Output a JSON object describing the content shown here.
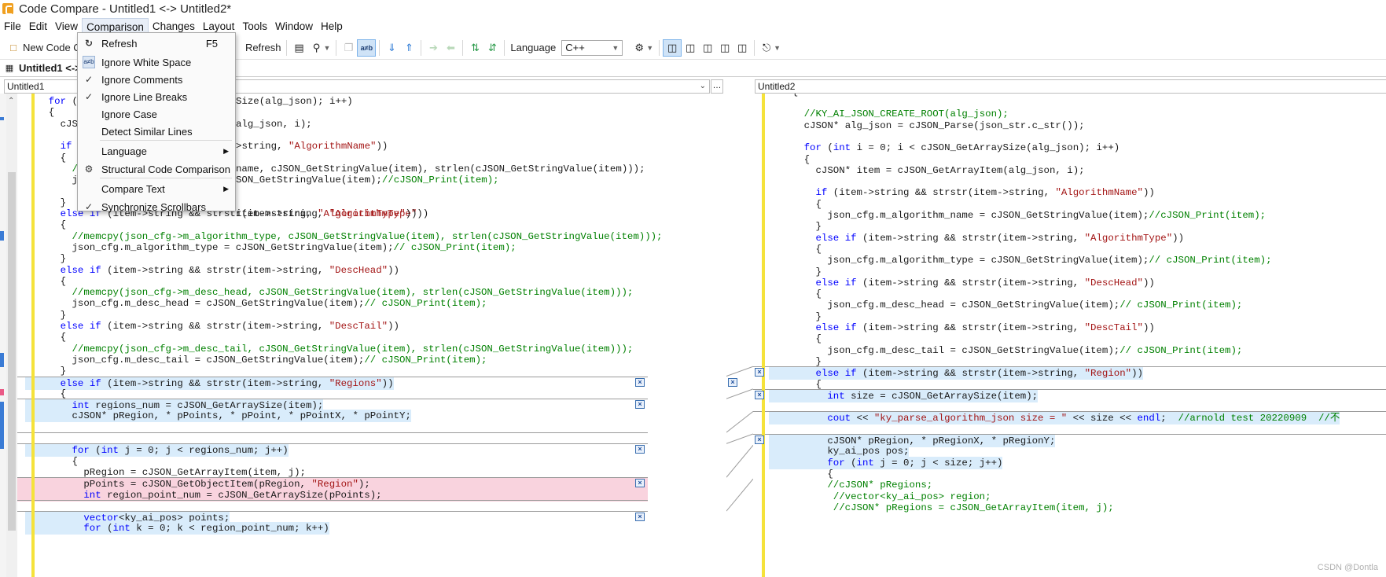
{
  "window": {
    "title": "Code Compare - Untitled1 <-> Untitled2*"
  },
  "menubar": [
    "File",
    "Edit",
    "View",
    "Comparison",
    "Changes",
    "Layout",
    "Tools",
    "Window",
    "Help"
  ],
  "toolbar": {
    "new_code": "New Code Co",
    "refresh": "Refresh",
    "language_label": "Language",
    "language_value": "C++"
  },
  "doc_tab": {
    "label": "Untitled1 <-> U"
  },
  "left_header": "Untitled1",
  "right_header": "Untitled2",
  "comparison_menu": {
    "items": [
      {
        "label": "Refresh",
        "shortcut": "F5",
        "icon": "refresh-icon"
      },
      {
        "label": "Ignore White Space",
        "icon": "axb-icon"
      },
      {
        "label": "Ignore Comments",
        "icon": "check-icon",
        "checked": true
      },
      {
        "label": "Ignore Line Breaks",
        "icon": "check-icon",
        "checked": true
      },
      {
        "label": "Ignore Case"
      },
      {
        "label": "Detect Similar Lines"
      },
      {
        "label": "Language",
        "submenu": true
      },
      {
        "label": "Structural Code Comparison",
        "icon": "structure-icon"
      },
      {
        "label": "Compare Text",
        "submenu": true
      },
      {
        "label": "Synchronize Scrollbars",
        "icon": "check-icon",
        "checked": true
      }
    ]
  },
  "left_lines": [
    "    for (i",
    "    {",
    "      cJSON",
    "",
    "      if (",
    "      {",
    "        //",
    "        js",
    "",
    "      }",
    "      else if (item->string && strstr(item->string, \"AlgorithmType\"))",
    "      {",
    "        //memcpy(json_cfg->m_algorithm_type, cJSON_GetStringValue(item), strlen(cJSON_GetStringValue(item)));",
    "        json_cfg.m_algorithm_type = cJSON_GetStringValue(item);// cJSON_Print(item);",
    "      }",
    "      else if (item->string && strstr(item->string, \"DescHead\"))",
    "      {",
    "        //memcpy(json_cfg->m_desc_head, cJSON_GetStringValue(item), strlen(cJSON_GetStringValue(item)));",
    "        json_cfg.m_desc_head = cJSON_GetStringValue(item);// cJSON_Print(item);",
    "      }",
    "      else if (item->string && strstr(item->string, \"DescTail\"))",
    "      {",
    "        //memcpy(json_cfg->m_desc_tail, cJSON_GetStringValue(item), strlen(cJSON_GetStringValue(item)));",
    "        json_cfg.m_desc_tail = cJSON_GetStringValue(item);// cJSON_Print(item);",
    "      }",
    "      else if (item->string && strstr(item->string, \"Regions\"))",
    "      {",
    "        int regions_num = cJSON_GetArraySize(item);",
    "        cJSON* pRegion, * pPoints, * pPoint, * pPointX, * pPointY;",
    "",
    "",
    "        for (int j = 0; j < regions_num; j++)",
    "        {",
    "          pRegion = cJSON_GetArrayItem(item, j);",
    "          pPoints = cJSON_GetObjectItem(pRegion, \"Region\");",
    "          int region_point_num = cJSON_GetArraySize(pPoints);",
    "",
    "          vector<ky_ai_pos> points;",
    "          for (int k = 0; k < region_point_num; k++)"
  ],
  "left_fragments": {
    "l0": "Size(alg_json); i++)",
    "l2": "alg_json, i);",
    "l4": ">string, \"AlgorithmName\"))",
    "l6": "name, cJSON_GetStringValue(item), strlen(cJSON_GetStringValue(item)));",
    "l7": "SON_GetStringValue(item);//cJSON_Print(item);",
    "l10": "item->string, \"AlgorithmType\"))"
  },
  "right_lines": [
    "    {",
    "",
    "      //KY_AI_JSON_CREATE_ROOT(alg_json);",
    "      cJSON* alg_json = cJSON_Parse(json_str.c_str());",
    "",
    "      for (int i = 0; i < cJSON_GetArraySize(alg_json); i++)",
    "      {",
    "        cJSON* item = cJSON_GetArrayItem(alg_json, i);",
    "",
    "        if (item->string && strstr(item->string, \"AlgorithmName\"))",
    "        {",
    "          json_cfg.m_algorithm_name = cJSON_GetStringValue(item);//cJSON_Print(item);",
    "        }",
    "        else if (item->string && strstr(item->string, \"AlgorithmType\"))",
    "        {",
    "          json_cfg.m_algorithm_type = cJSON_GetStringValue(item);// cJSON_Print(item);",
    "        }",
    "        else if (item->string && strstr(item->string, \"DescHead\"))",
    "        {",
    "          json_cfg.m_desc_head = cJSON_GetStringValue(item);// cJSON_Print(item);",
    "        }",
    "        else if (item->string && strstr(item->string, \"DescTail\"))",
    "        {",
    "          json_cfg.m_desc_tail = cJSON_GetStringValue(item);// cJSON_Print(item);",
    "        }",
    "        else if (item->string && strstr(item->string, \"Region\"))",
    "        {",
    "          int size = cJSON_GetArraySize(item);",
    "",
    "          cout << \"ky_parse_algorithm_json size = \" << size << endl;  //arnold test 20220909  //不",
    "",
    "          cJSON* pRegion, * pRegionX, * pRegionY;",
    "          ky_ai_pos pos;",
    "          for (int j = 0; j < size; j++)",
    "          {",
    "          //cJSON* pRegions;",
    "           //vector<ky_ai_pos> region;",
    "           //cJSON* pRegions = cJSON_GetArrayItem(item, j);"
  ],
  "watermark": "CSDN @Dontla",
  "colors": {
    "keyword": "#0000ff",
    "string": "#a31515",
    "comment": "#008000",
    "changed_bg": "#d9ecfb",
    "deleted_bg": "#f9d3de",
    "change_bar": "#f5e23a"
  }
}
